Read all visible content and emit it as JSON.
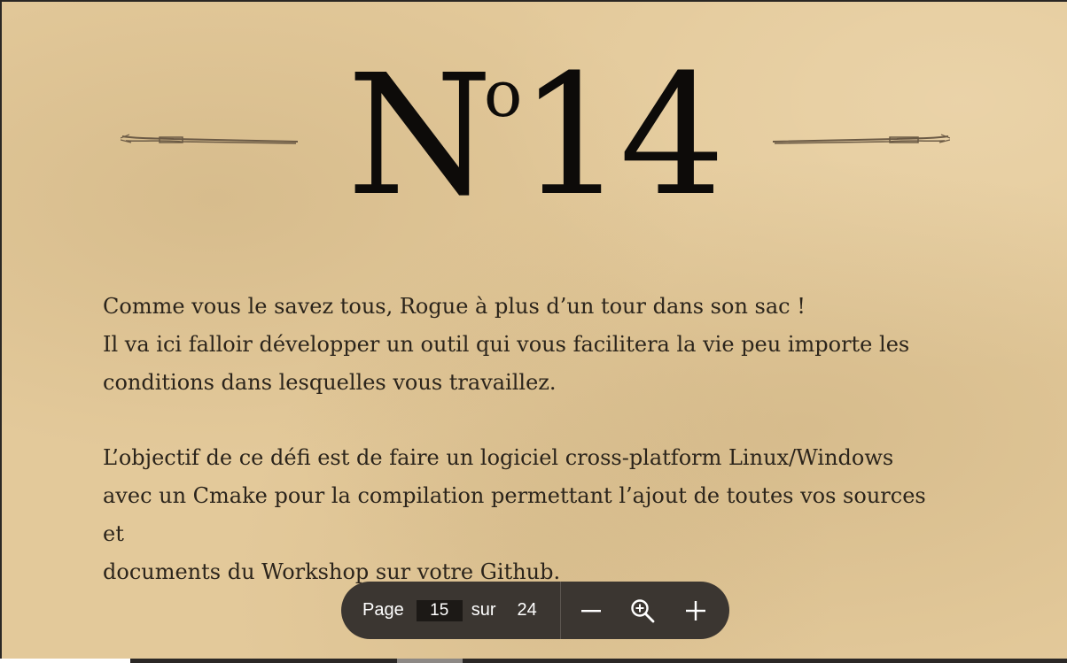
{
  "document": {
    "title_letter": "N",
    "title_superscript": "o",
    "title_number": "14",
    "paragraphs": [
      [
        " Comme vous le savez tous, Rogue à plus d’un tour dans son sac !",
        "Il va ici falloir développer un outil qui vous facilitera la vie peu importe les",
        "conditions dans lesquelles vous travaillez."
      ],
      [
        "L’objectif de ce défi est de faire un logiciel cross-platform Linux/Windows",
        "avec un Cmake pour la compilation permettant l’ajout de toutes vos sources et",
        "documents du Workshop sur votre Github."
      ]
    ]
  },
  "toolbar": {
    "page_label": "Page",
    "page_value": "15",
    "of_label": "sur",
    "total_pages": "24",
    "zoom_out_icon": "minus-icon",
    "zoom_fit_icon": "zoom-magnifier-icon",
    "zoom_in_icon": "plus-icon"
  },
  "colors": {
    "parchment": "#e3c99a",
    "ink": "#0d0b09",
    "body_text": "#2b241b",
    "toolbar_bg": "#3b3631"
  }
}
